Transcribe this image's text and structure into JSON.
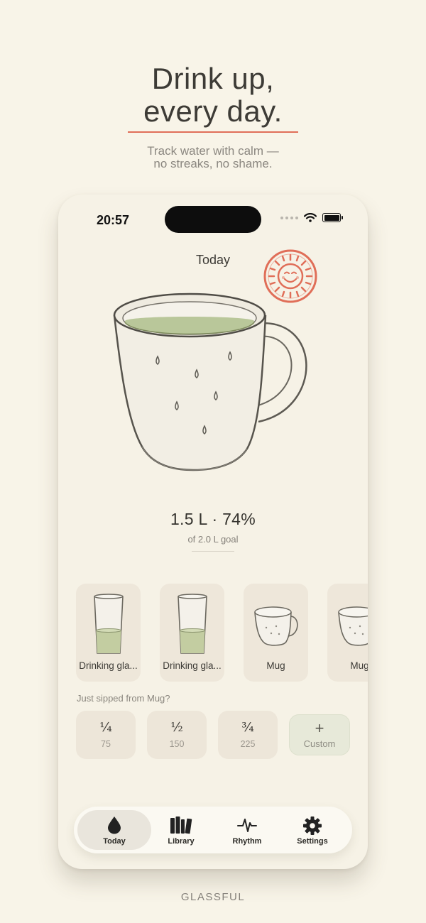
{
  "hero": {
    "title_line1": "Drink up,",
    "title_line2": "every day.",
    "subtitle_line1": "Track water with calm —",
    "subtitle_line2": "no streaks, no shame."
  },
  "status_bar": {
    "time": "20:57"
  },
  "today": {
    "title": "Today",
    "amount": "1.5 L · 74%",
    "goal": "of 2.0 L goal",
    "progress_fraction": 0.74
  },
  "vessels": [
    {
      "label": "Drinking gla...",
      "icon": "glass-icon",
      "fill": 0.35
    },
    {
      "label": "Drinking gla...",
      "icon": "glass-icon",
      "fill": 0.35
    },
    {
      "label": "Mug",
      "icon": "mug-icon"
    },
    {
      "label": "Mug",
      "icon": "mug-icon"
    }
  ],
  "sipped_prompt": "Just sipped from Mug?",
  "portions": [
    {
      "fraction": "¼",
      "ml": "75"
    },
    {
      "fraction": "½",
      "ml": "150"
    },
    {
      "fraction": "¾",
      "ml": "225"
    }
  ],
  "custom": {
    "symbol": "+",
    "label": "Custom"
  },
  "tabs": [
    {
      "label": "Today",
      "icon": "water-drop-icon",
      "active": true
    },
    {
      "label": "Library",
      "icon": "library-books-icon"
    },
    {
      "label": "Rhythm",
      "icon": "pulse-icon"
    },
    {
      "label": "Settings",
      "icon": "gear-icon"
    }
  ],
  "brand": "GLASSFUL",
  "colors": {
    "background": "#f8f4e8",
    "accent": "#e06e58",
    "water": "#b9c79a",
    "card": "#eee7da"
  }
}
